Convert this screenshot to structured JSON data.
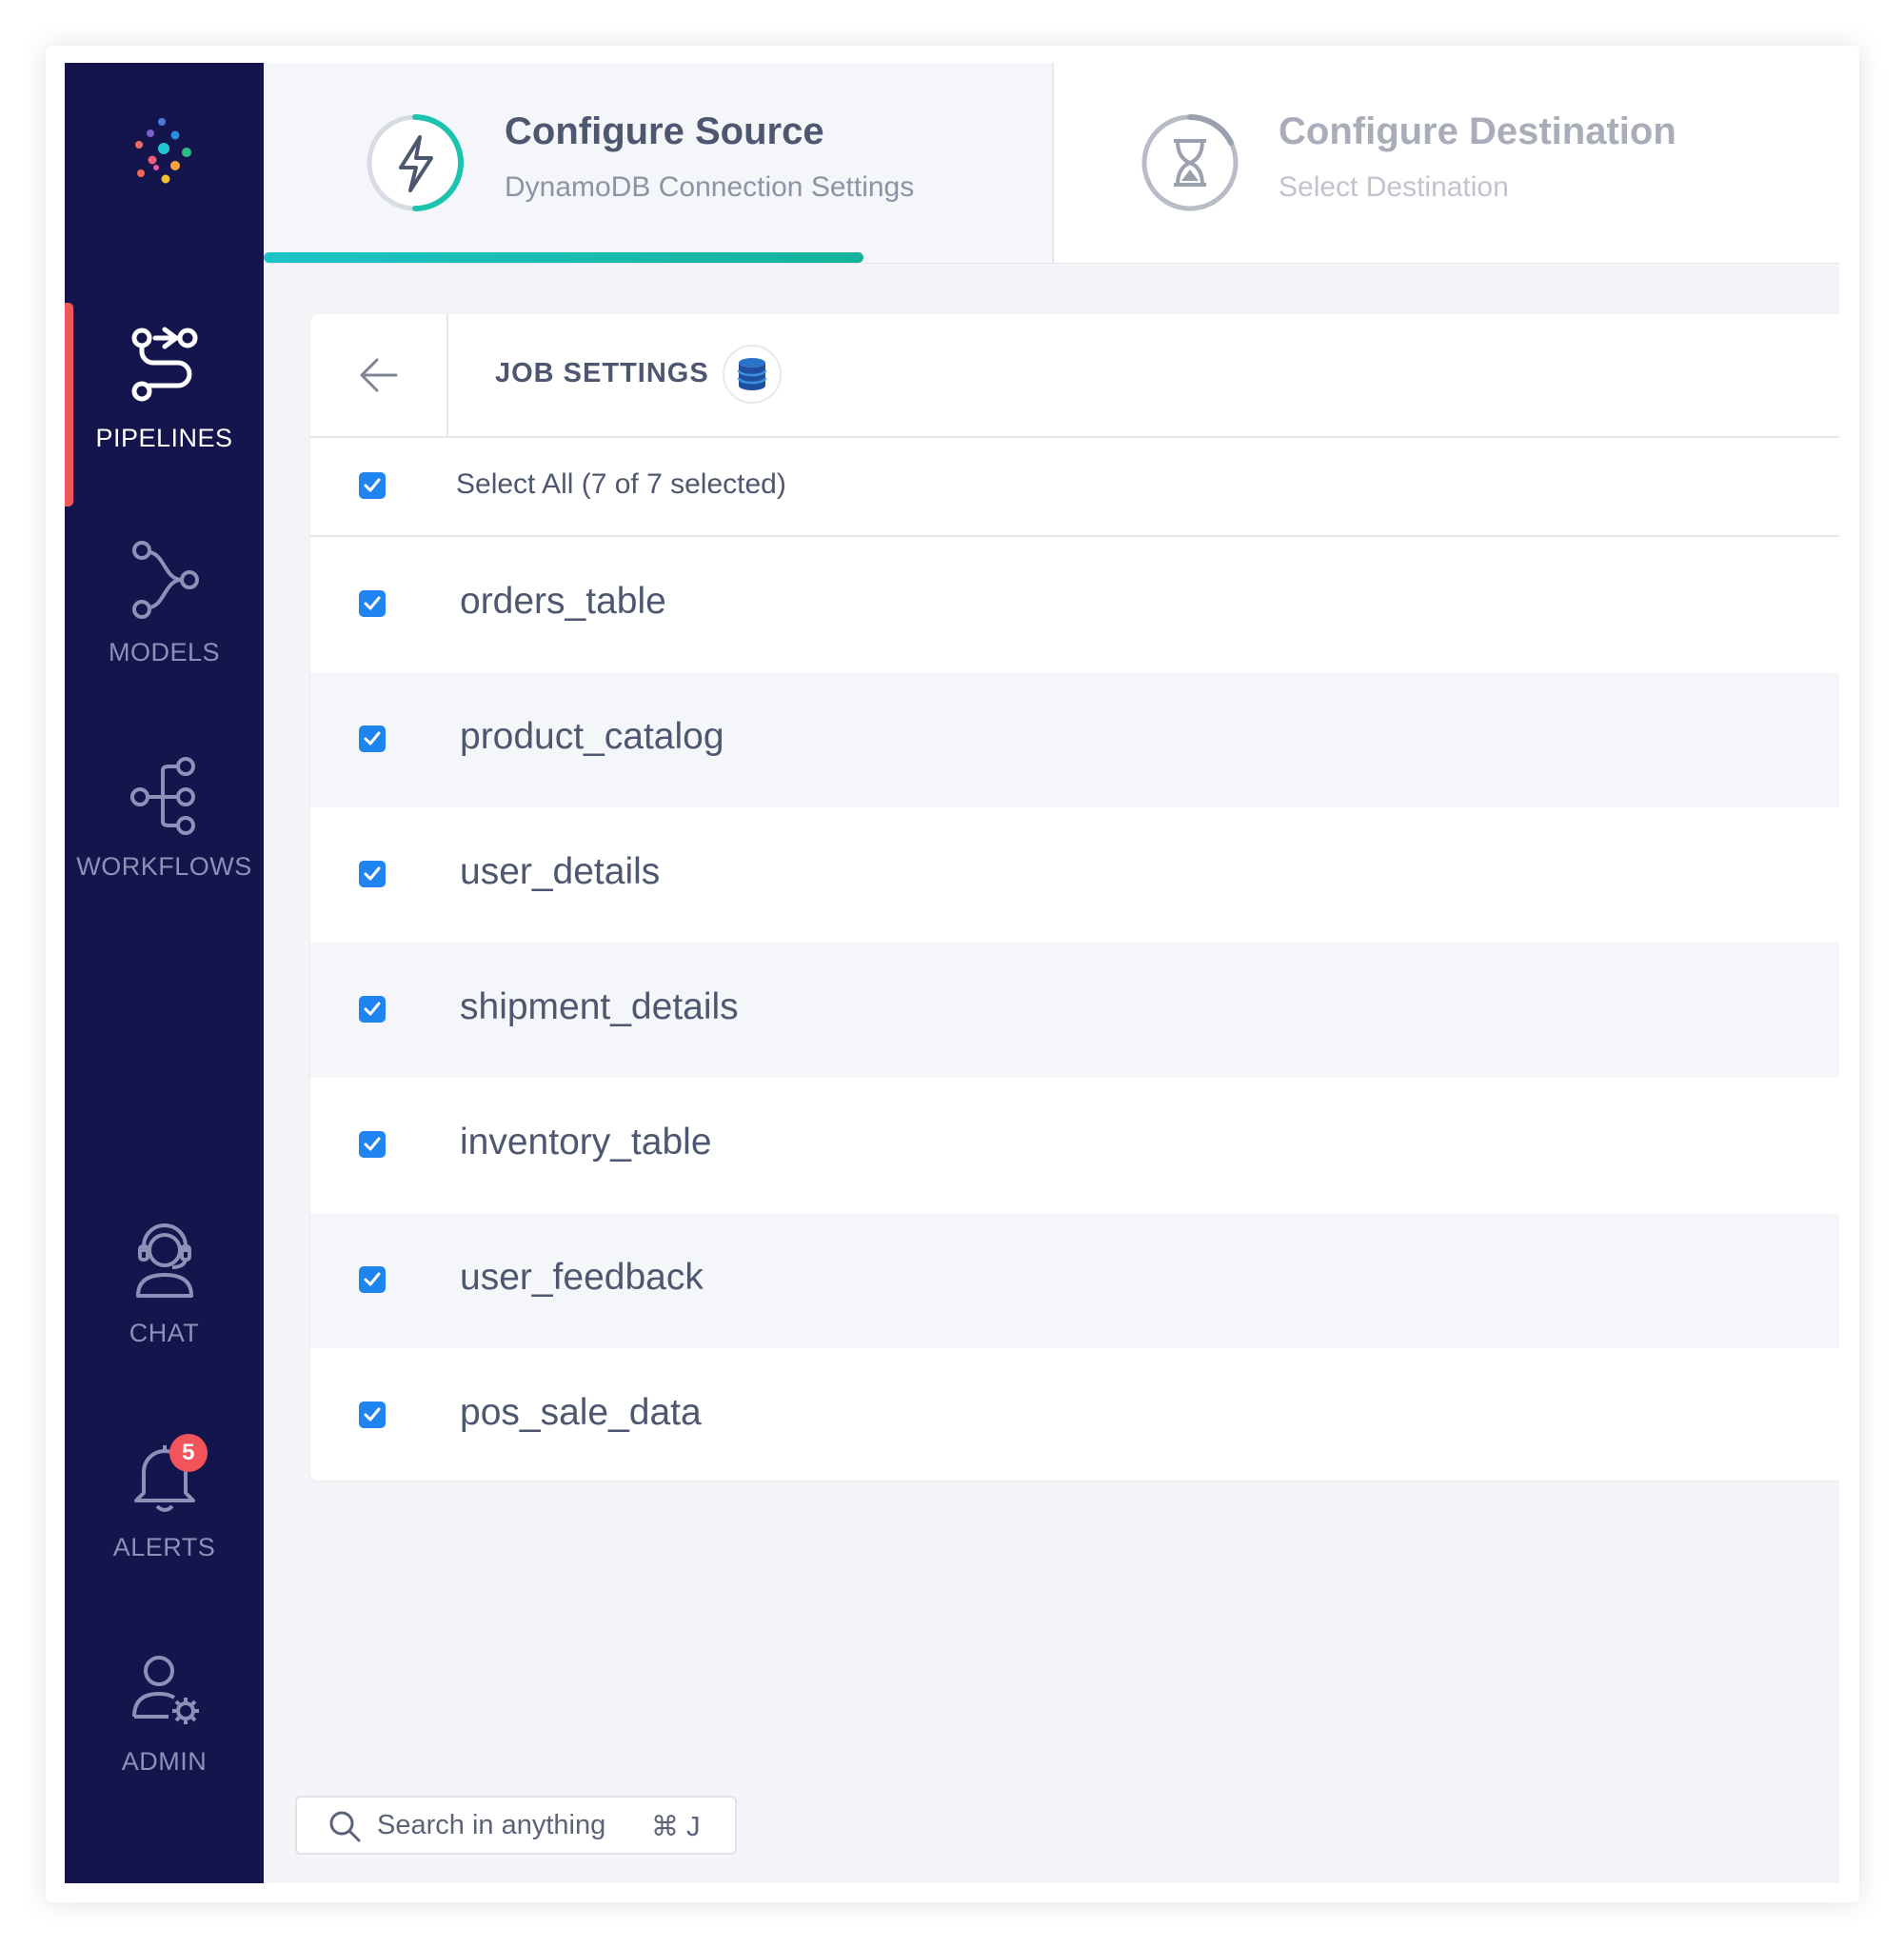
{
  "sidebar": {
    "items": [
      {
        "label": "PIPELINES",
        "icon": "pipelines-icon",
        "active": true
      },
      {
        "label": "MODELS",
        "icon": "models-icon",
        "active": false
      },
      {
        "label": "WORKFLOWS",
        "icon": "workflows-icon",
        "active": false
      },
      {
        "label": "CHAT",
        "icon": "chat-headset-icon",
        "active": false
      },
      {
        "label": "ALERTS",
        "icon": "bell-icon",
        "active": false,
        "badge": "5"
      },
      {
        "label": "ADMIN",
        "icon": "admin-user-gear-icon",
        "active": false
      }
    ]
  },
  "stepper": {
    "steps": [
      {
        "title": "Configure Source",
        "subtitle": "DynamoDB Connection Settings",
        "icon": "lightning-icon",
        "state": "active"
      },
      {
        "title": "Configure Destination",
        "subtitle": "Select Destination",
        "icon": "hourglass-icon",
        "state": "pending"
      }
    ]
  },
  "job_settings": {
    "title": "JOB SETTINGS",
    "source_icon": "dynamodb-icon",
    "select_all_label": "Select All (7 of 7 selected)",
    "tables": [
      {
        "name": "orders_table",
        "checked": true
      },
      {
        "name": "product_catalog",
        "checked": true
      },
      {
        "name": "user_details",
        "checked": true
      },
      {
        "name": "shipment_details",
        "checked": true
      },
      {
        "name": "inventory_table",
        "checked": true
      },
      {
        "name": "user_feedback",
        "checked": true
      },
      {
        "name": "pos_sale_data",
        "checked": true
      }
    ]
  },
  "search": {
    "placeholder": "Search in anything",
    "shortcut": "⌘ J"
  },
  "colors": {
    "sidebar_bg": "#14154d",
    "active_indicator": "#f0575b",
    "progress": "#1cc4c7",
    "checkbox": "#1f83f0",
    "badge": "#f1545b"
  }
}
